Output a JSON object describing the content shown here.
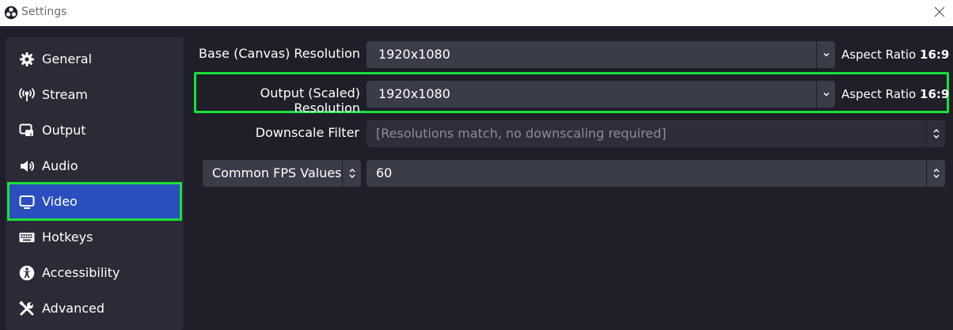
{
  "window": {
    "title": "Settings"
  },
  "sidebar": {
    "items": [
      {
        "label": "General",
        "icon": "gear-icon"
      },
      {
        "label": "Stream",
        "icon": "antenna-icon"
      },
      {
        "label": "Output",
        "icon": "output-icon"
      },
      {
        "label": "Audio",
        "icon": "speaker-icon"
      },
      {
        "label": "Video",
        "icon": "monitor-icon",
        "active": true
      },
      {
        "label": "Hotkeys",
        "icon": "keyboard-icon"
      },
      {
        "label": "Accessibility",
        "icon": "accessibility-icon"
      },
      {
        "label": "Advanced",
        "icon": "tools-icon"
      }
    ]
  },
  "video": {
    "base_resolution": {
      "label": "Base (Canvas) Resolution",
      "value": "1920x1080",
      "aspect_prefix": "Aspect Ratio",
      "aspect_value": "16:9"
    },
    "output_resolution": {
      "label": "Output (Scaled) Resolution",
      "value": "1920x1080",
      "aspect_prefix": "Aspect Ratio",
      "aspect_value": "16:9"
    },
    "downscale_filter": {
      "label": "Downscale Filter",
      "value": "[Resolutions match, no downscaling required]"
    },
    "fps": {
      "type_label": "Common FPS Values",
      "value": "60"
    }
  },
  "colors": {
    "accent": "#2a4ebd",
    "highlight": "#19e13b",
    "background": "#1e1f28",
    "sidebar": "#2a2b36",
    "field": "#3b3c4a"
  }
}
